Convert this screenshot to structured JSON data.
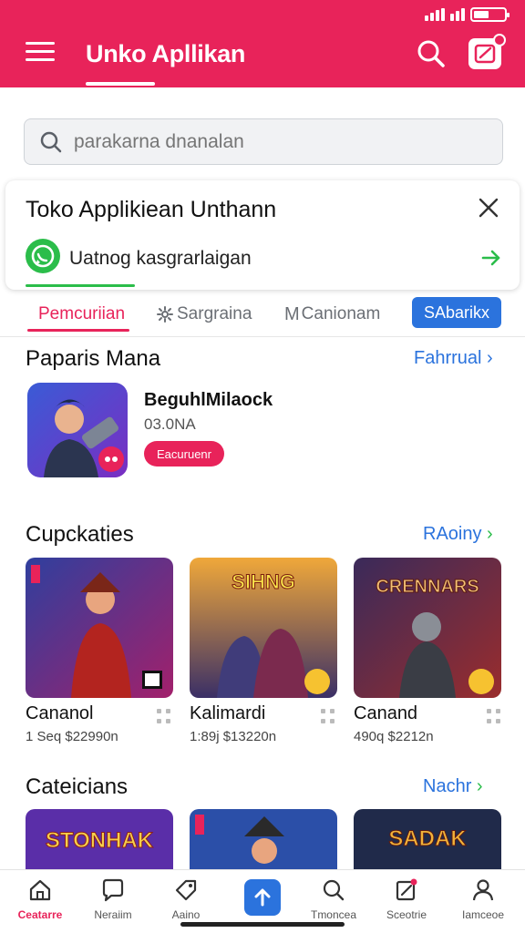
{
  "header": {
    "title": "Unko Apllikan",
    "colors": {
      "primary": "#e8235a",
      "link": "#2b73dd",
      "green": "#2bbd4a"
    }
  },
  "search": {
    "placeholder": "parakarna dnanalan"
  },
  "card": {
    "title": "Toko Applikiean Unthann",
    "subtitle": "Uatnog kasgrarlaigan"
  },
  "tabs": [
    {
      "label": "Pemcuriian",
      "active": true
    },
    {
      "label": "Sargraina",
      "icon": "gear-icon"
    },
    {
      "label": "Canionam",
      "icon": "m-icon"
    },
    {
      "label": "SAbarikx",
      "pill": true
    }
  ],
  "featured": {
    "title": "Paparis Mana",
    "link": "Fahrrual",
    "app_name": "BeguhlMilaock",
    "size": "03.0NA",
    "button": "Eacuruenr"
  },
  "section2": {
    "title": "Cupckaties",
    "link": "RAoiny",
    "items": [
      {
        "name": "Cananol",
        "meta": "1 Seq $22990n"
      },
      {
        "name": "Kalimardi",
        "meta": "1:89j $13220n"
      },
      {
        "name": "Canand",
        "meta": "490q $2212n"
      }
    ],
    "tile_texts": [
      "SIHNG",
      "CRENNARS"
    ]
  },
  "section3": {
    "title": "Cateicians",
    "link": "Nachr",
    "tile_texts": [
      "STONHAK",
      "SADAK"
    ]
  },
  "bottom_nav": [
    {
      "label": "Ceatarre",
      "icon": "home-icon",
      "active": true
    },
    {
      "label": "Neraiim",
      "icon": "chat-icon"
    },
    {
      "label": "Aaino",
      "icon": "tag-icon"
    },
    {
      "label": "",
      "icon": "upload-icon"
    },
    {
      "label": "Tmoncea",
      "icon": "search-person-icon"
    },
    {
      "label": "Sceotrie",
      "icon": "edit-icon"
    },
    {
      "label": "Iamceoe",
      "icon": "profile-icon"
    }
  ]
}
